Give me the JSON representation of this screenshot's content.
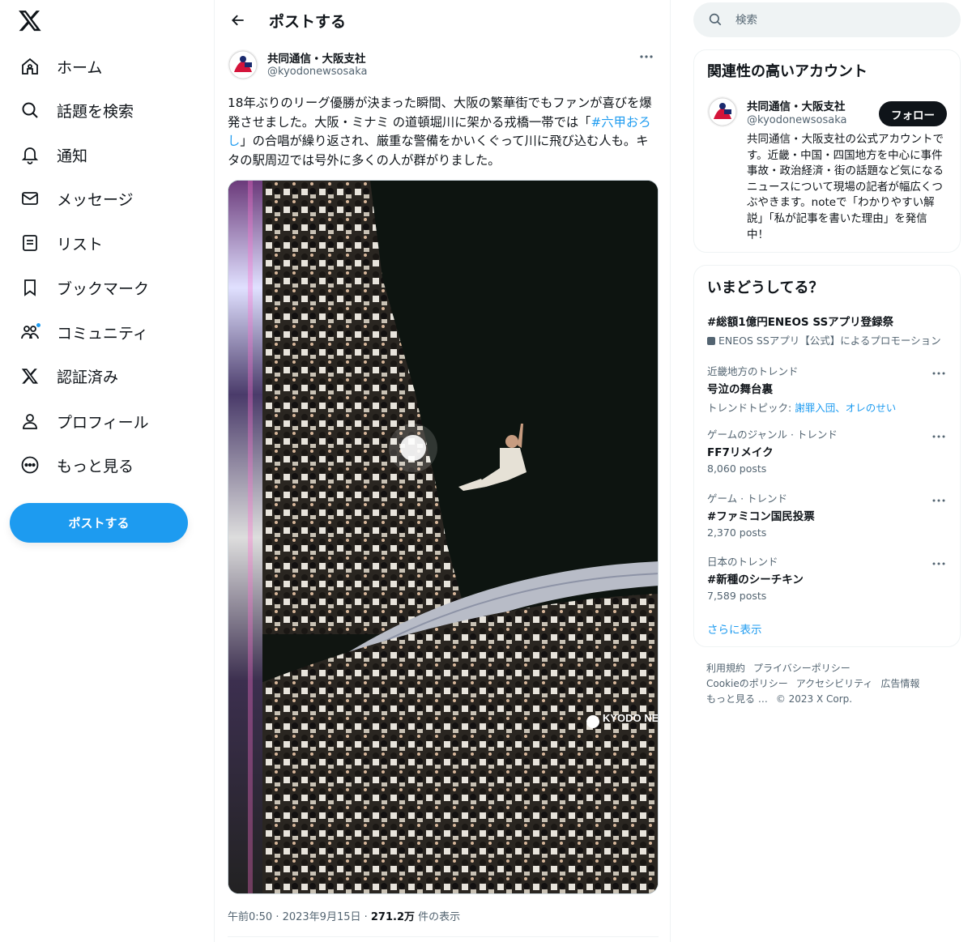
{
  "nav": {
    "items": [
      {
        "label": "ホーム",
        "icon": "home-icon"
      },
      {
        "label": "話題を検索",
        "icon": "search-icon"
      },
      {
        "label": "通知",
        "icon": "bell-icon"
      },
      {
        "label": "メッセージ",
        "icon": "mail-icon"
      },
      {
        "label": "リスト",
        "icon": "list-icon"
      },
      {
        "label": "ブックマーク",
        "icon": "bookmark-icon"
      },
      {
        "label": "コミュニティ",
        "icon": "communities-icon"
      },
      {
        "label": "認証済み",
        "icon": "x-verified-icon"
      },
      {
        "label": "プロフィール",
        "icon": "person-icon"
      },
      {
        "label": "もっと見る",
        "icon": "more-circle-icon"
      }
    ],
    "post_button": "ポストする",
    "accent": "#1d9bf0"
  },
  "main": {
    "header_title": "ポストする",
    "author": {
      "name": "共同通信・大阪支社",
      "handle": "@kyodonewsosaka"
    },
    "text_before": "18年ぶりのリーグ優勝が決まった瞬間、大阪の繁華街でもファンが喜びを爆発させました。大阪・ミナミ の道頓堀川に架かる戎橋一帯では「",
    "hashtag": "#六甲おろし",
    "text_after": "」の合唱が繰り返され、厳重な警備をかいくぐって川に飛び込む人も。キタの駅周辺では号外に多くの人が群がりました。",
    "image_watermark": "KYODO NEWS",
    "meta": {
      "time": "午前0:50 · 2023年9月15日 · ",
      "views": "271.2万",
      "views_suffix": " 件の表示"
    }
  },
  "right": {
    "search_placeholder": "検索",
    "related": {
      "title": "関連性の高いアカウント",
      "name": "共同通信・大阪支社",
      "handle": "@kyodonewsosaka",
      "follow": "フォロー",
      "bio": "共同通信・大阪支社の公式アカウントです。近畿・中国・四国地方を中心に事件事故・政治経済・街の話題など気になるニュースについて現場の記者が幅広くつぶやきます。noteで「わかりやすい解説」「私が記事を書いた理由」を発信中！"
    },
    "trends": {
      "title": "いまどうしてる？",
      "promo": {
        "title": "#総額1億円ENEOS SSアプリ登録祭",
        "sub": "ENEOS SSアプリ【公式】によるプロモーション"
      },
      "items": [
        {
          "category": "近畿地方のトレンド",
          "title": "号泣の舞台裏",
          "sub_prefix": "トレンドトピック: ",
          "sub_links": "謝罪入団、オレのせい"
        },
        {
          "category": "ゲームのジャンル · トレンド",
          "title": "FF7リメイク",
          "posts": "8,060 posts"
        },
        {
          "category": "ゲーム · トレンド",
          "title": "#ファミコン国民投票",
          "posts": "2,370 posts"
        },
        {
          "category": "日本のトレンド",
          "title": "#新種のシーチキン",
          "posts": "7,589 posts"
        }
      ],
      "show_more": "さらに表示"
    },
    "footer": {
      "line1": [
        "利用規約",
        "プライバシーポリシー"
      ],
      "line2": [
        "Cookieのポリシー",
        "アクセシビリティ",
        "広告情報"
      ],
      "line3": [
        "もっと見る …",
        "© 2023 X Corp."
      ]
    }
  }
}
